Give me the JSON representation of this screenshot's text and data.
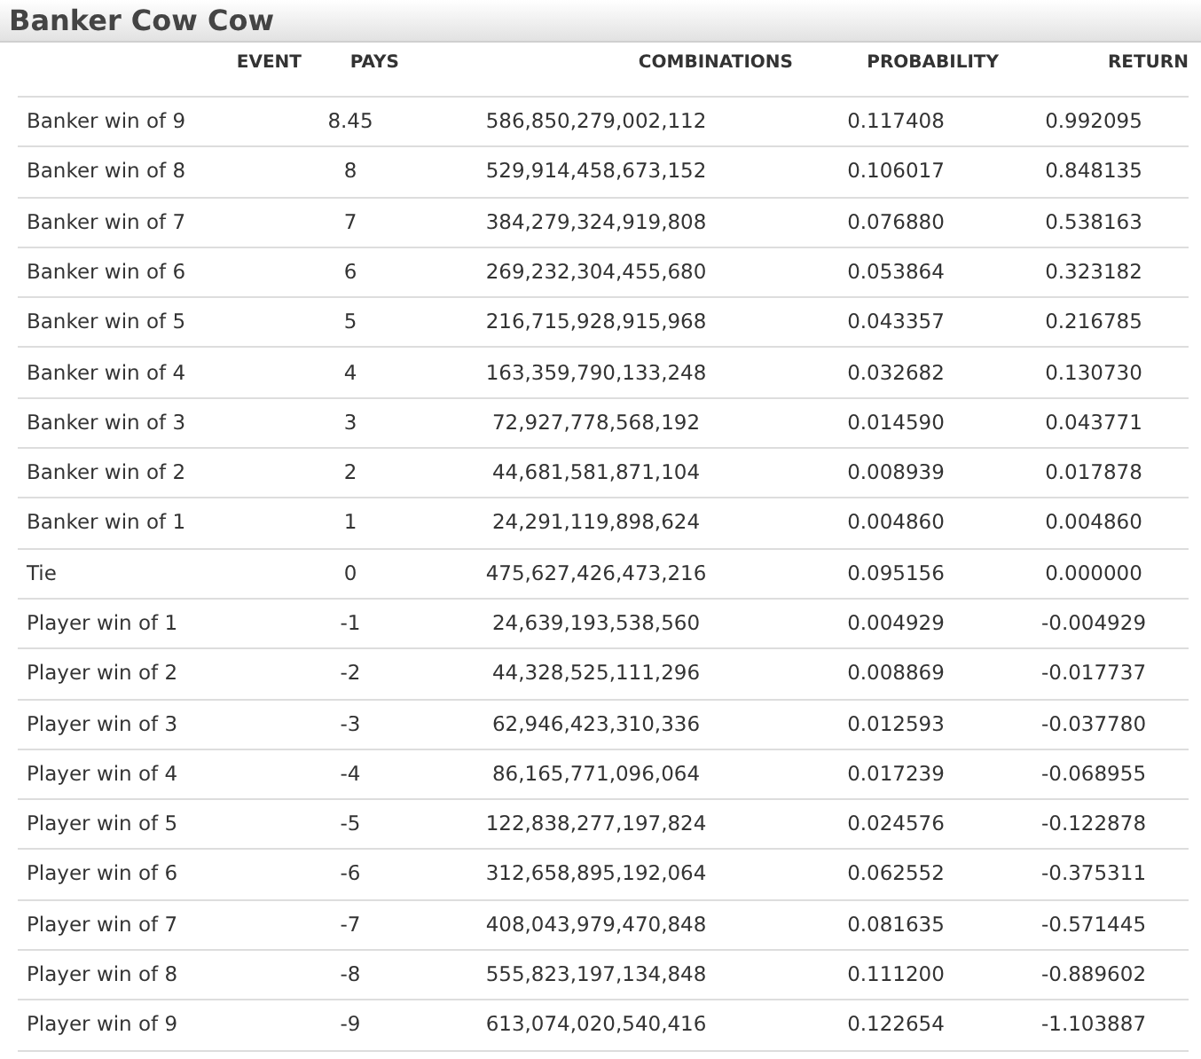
{
  "title": "Banker Cow Cow",
  "table": {
    "columns": [
      "EVENT",
      "PAYS",
      "COMBINATIONS",
      "PROBABILITY",
      "RETURN"
    ],
    "rows": [
      [
        "Banker win of 9",
        "8.45",
        "586,850,279,002,112",
        "0.117408",
        "0.992095"
      ],
      [
        "Banker win of 8",
        "8",
        "529,914,458,673,152",
        "0.106017",
        "0.848135"
      ],
      [
        "Banker win of 7",
        "7",
        "384,279,324,919,808",
        "0.076880",
        "0.538163"
      ],
      [
        "Banker win of 6",
        "6",
        "269,232,304,455,680",
        "0.053864",
        "0.323182"
      ],
      [
        "Banker win of 5",
        "5",
        "216,715,928,915,968",
        "0.043357",
        "0.216785"
      ],
      [
        "Banker win of 4",
        "4",
        "163,359,790,133,248",
        "0.032682",
        "0.130730"
      ],
      [
        "Banker win of 3",
        "3",
        "72,927,778,568,192",
        "0.014590",
        "0.043771"
      ],
      [
        "Banker win of 2",
        "2",
        "44,681,581,871,104",
        "0.008939",
        "0.017878"
      ],
      [
        "Banker win of 1",
        "1",
        "24,291,119,898,624",
        "0.004860",
        "0.004860"
      ],
      [
        "Tie",
        "0",
        "475,627,426,473,216",
        "0.095156",
        "0.000000"
      ],
      [
        "Player win of 1",
        "-1",
        "24,639,193,538,560",
        "0.004929",
        "-0.004929"
      ],
      [
        "Player win of 2",
        "-2",
        "44,328,525,111,296",
        "0.008869",
        "-0.017737"
      ],
      [
        "Player win of 3",
        "-3",
        "62,946,423,310,336",
        "0.012593",
        "-0.037780"
      ],
      [
        "Player win of 4",
        "-4",
        "86,165,771,096,064",
        "0.017239",
        "-0.068955"
      ],
      [
        "Player win of 5",
        "-5",
        "122,838,277,197,824",
        "0.024576",
        "-0.122878"
      ],
      [
        "Player win of 6",
        "-6",
        "312,658,895,192,064",
        "0.062552",
        "-0.375311"
      ],
      [
        "Player win of 7",
        "-7",
        "408,043,979,470,848",
        "0.081635",
        "-0.571445"
      ],
      [
        "Player win of 8",
        "-8",
        "555,823,197,134,848",
        "0.111200",
        "-0.889602"
      ],
      [
        "Player win of 9",
        "-9",
        "613,074,020,540,416",
        "0.122654",
        "-1.103887"
      ]
    ]
  }
}
